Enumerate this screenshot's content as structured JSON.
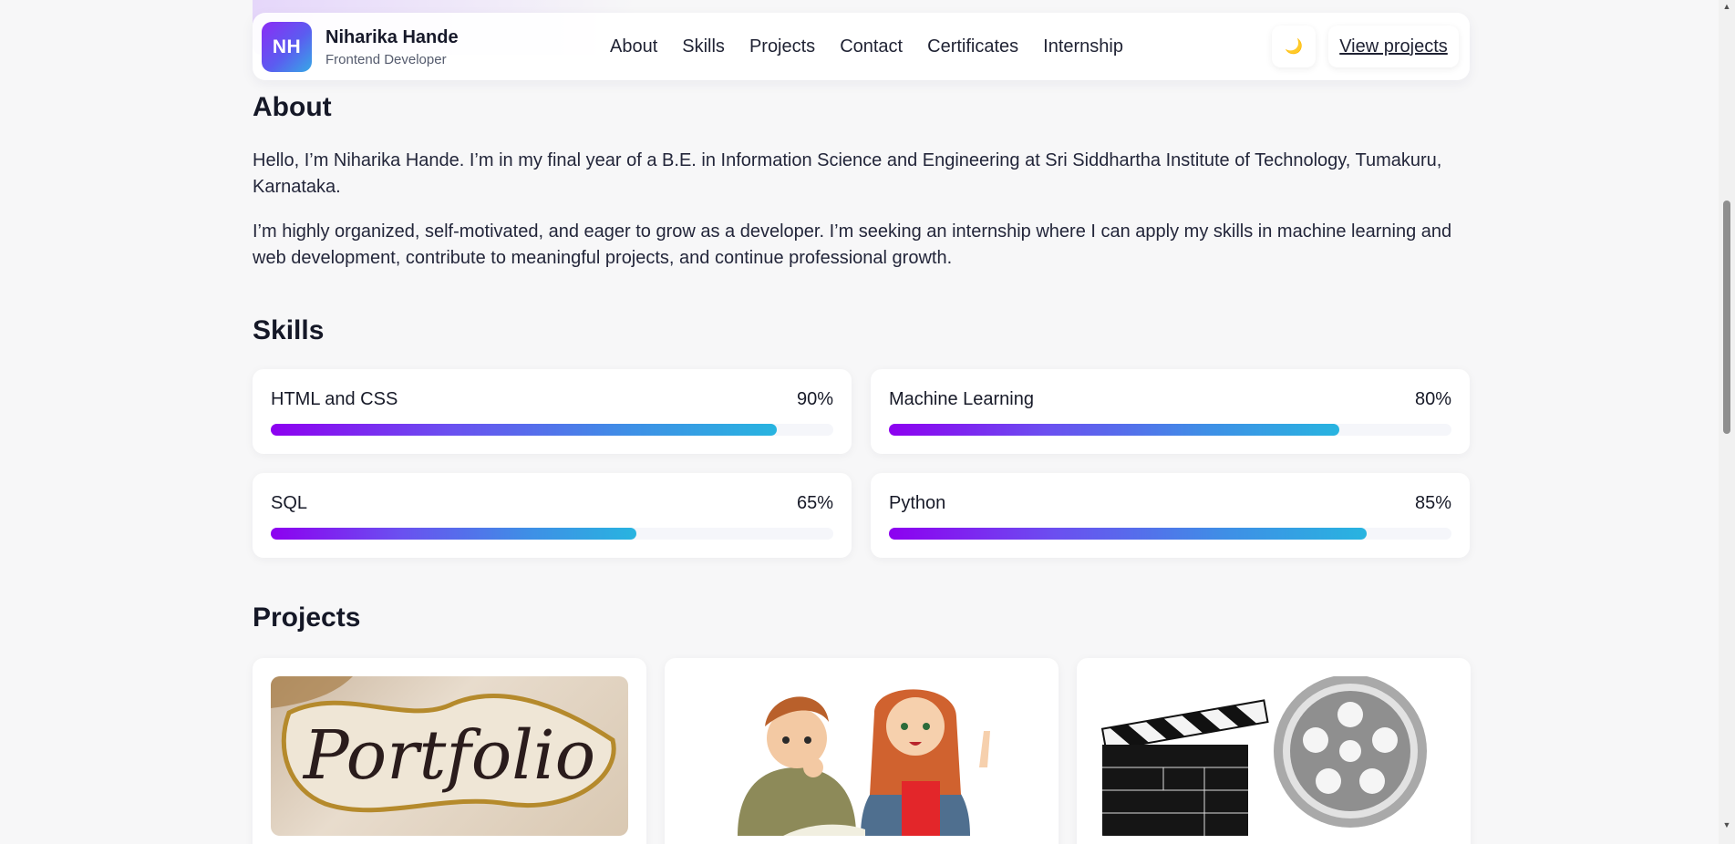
{
  "header": {
    "logo_initials": "NH",
    "name": "Niharika Hande",
    "role": "Frontend Developer",
    "nav": [
      "About",
      "Skills",
      "Projects",
      "Contact",
      "Certificates",
      "Internship"
    ],
    "theme_toggle_icon": "🌙",
    "cta_label": "View projects"
  },
  "about": {
    "title": "About",
    "paragraphs": [
      "Hello, I’m Niharika Hande. I’m in my final year of a B.E. in Information Science and Engineering at Sri Siddhartha Institute of Technology, Tumakuru, Karnataka.",
      "I’m highly organized, self-motivated, and eager to grow as a developer. I’m seeking an internship where I can apply my skills in machine learning and web development, contribute to meaningful projects, and continue professional growth."
    ]
  },
  "skills": {
    "title": "Skills",
    "items": [
      {
        "name": "HTML and CSS",
        "percent_label": "90%",
        "level": 0.9
      },
      {
        "name": "Machine Learning",
        "percent_label": "80%",
        "level": 0.8
      },
      {
        "name": "SQL",
        "percent_label": "65%",
        "level": 0.65
      },
      {
        "name": "Python",
        "percent_label": "85%",
        "level": 0.85
      }
    ]
  },
  "projects": {
    "title": "Projects",
    "images": [
      {
        "icon": "portfolio-lettering-image",
        "text": "Portfolio"
      },
      {
        "icon": "students-illustration-image"
      },
      {
        "icon": "film-clapper-reel-image"
      }
    ]
  },
  "colors": {
    "accent_start": "#8d00f0",
    "accent_end": "#28b4e0",
    "heading": "#151827",
    "background": "#f7f7f8"
  }
}
